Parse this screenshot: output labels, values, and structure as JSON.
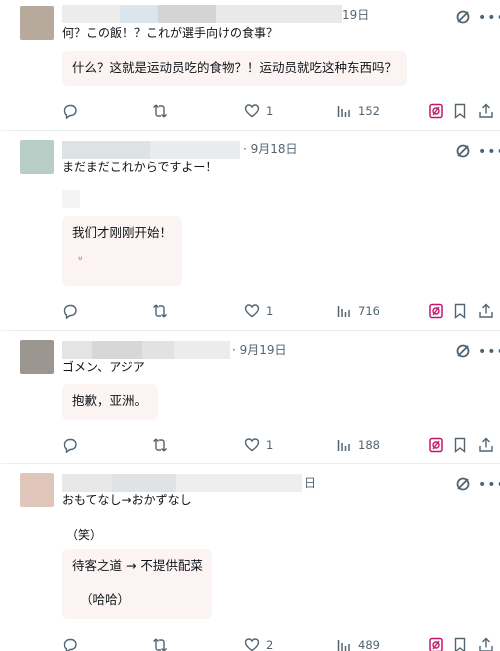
{
  "colors": {
    "text": "#0f1419",
    "muted": "#536471",
    "translation_bg": "#fcf3f3",
    "grok_icon": "#c2186b",
    "separator": "#e6ecf0"
  },
  "posts": [
    {
      "date": "19日",
      "text": "何？この飯！？これが選手向けの食事？",
      "translation": [
        "什么？这就是运动员吃的食物？！运动员就吃这种东西吗？"
      ],
      "stats": {
        "likes": "1",
        "views": "152"
      }
    },
    {
      "date": "· 9月18日",
      "text": "まだまだこれからですよー！",
      "translation": [
        "我们才刚刚开始！",
        "ᐡ"
      ],
      "stats": {
        "likes": "1",
        "views": "716"
      }
    },
    {
      "date": "· 9月19日",
      "text": "ゴメン、アジア",
      "translation": [
        "抱歉，亚洲。"
      ],
      "stats": {
        "likes": "1",
        "views": "188"
      }
    },
    {
      "date": "日",
      "text": "おもてなし→おかずなし",
      "text2": "（笑）",
      "translation": [
        "待客之道 → 不提供配菜",
        "（哈哈）"
      ],
      "stats": {
        "likes": "2",
        "views": "489"
      }
    }
  ],
  "icons": {
    "reply": "reply-icon",
    "retweet": "retweet-icon",
    "like": "heart-icon",
    "views": "views-icon",
    "grok": "grok-icon",
    "bookmark": "bookmark-icon",
    "share": "share-icon",
    "more": "more-icon"
  }
}
